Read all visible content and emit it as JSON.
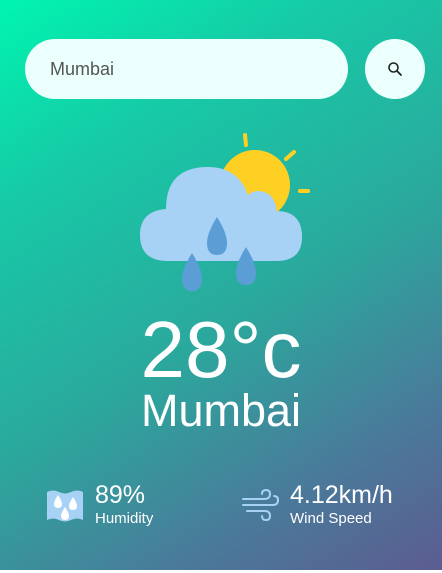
{
  "search": {
    "value": "Mumbai",
    "icon": "search-icon"
  },
  "weather": {
    "icon": "rain-cloud-sun-icon",
    "temperature": "28°c",
    "city": "Mumbai"
  },
  "details": {
    "humidity": {
      "icon": "humidity-icon",
      "value": "89%",
      "label": "Humidity"
    },
    "wind": {
      "icon": "wind-icon",
      "value": "4.12km/h",
      "label": "Wind Speed"
    }
  },
  "colors": {
    "gradient_start": "#00f5b0",
    "gradient_end": "#5c5c91",
    "search_bg": "#ebfffc",
    "cloud": "#a8d2f5",
    "sun": "#ffd024",
    "drop": "#5b9ed6"
  }
}
